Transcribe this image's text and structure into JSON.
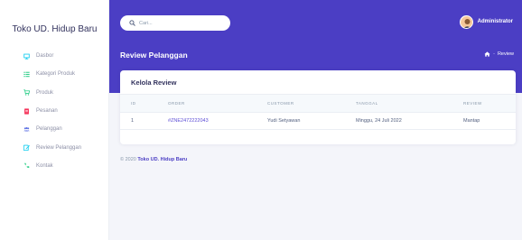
{
  "brand": "Toko UD. Hidup Baru",
  "nav": [
    {
      "label": "Dasbor",
      "icon": "monitor-icon",
      "color": "#11cdef"
    },
    {
      "label": "Kategori Produk",
      "icon": "list-icon",
      "color": "#2dce89"
    },
    {
      "label": "Produk",
      "icon": "cart-icon",
      "color": "#2dce89"
    },
    {
      "label": "Pesanan",
      "icon": "doc-icon",
      "color": "#f5365c"
    },
    {
      "label": "Pelanggan",
      "icon": "users-icon",
      "color": "#5e72e4"
    },
    {
      "label": "Review Pelanggan",
      "icon": "edit-icon",
      "color": "#11cdef"
    },
    {
      "label": "Kontak",
      "icon": "phone-icon",
      "color": "#2dce89"
    }
  ],
  "search": {
    "placeholder": "Cari..."
  },
  "user": {
    "name": "Administrator"
  },
  "header": {
    "title": "Review Pelanggan",
    "crumb_sep": "-",
    "crumb": "Review"
  },
  "card": {
    "title": "Kelola Review",
    "columns": [
      "ID",
      "ORDER",
      "CUSTOMER",
      "TANGGAL",
      "REVIEW"
    ],
    "rows": [
      {
        "id": "1",
        "order": "#ZNE2472222043",
        "customer": "Yudi Setyawan",
        "tanggal": "Minggu, 24 Juli 2022",
        "review": "Mantap"
      }
    ]
  },
  "footer": {
    "copyright": "© 2020",
    "brand": "Toko UD. Hidup Baru"
  },
  "colors": {
    "accent": "#4b3ec4",
    "link": "#5e4fd6"
  }
}
